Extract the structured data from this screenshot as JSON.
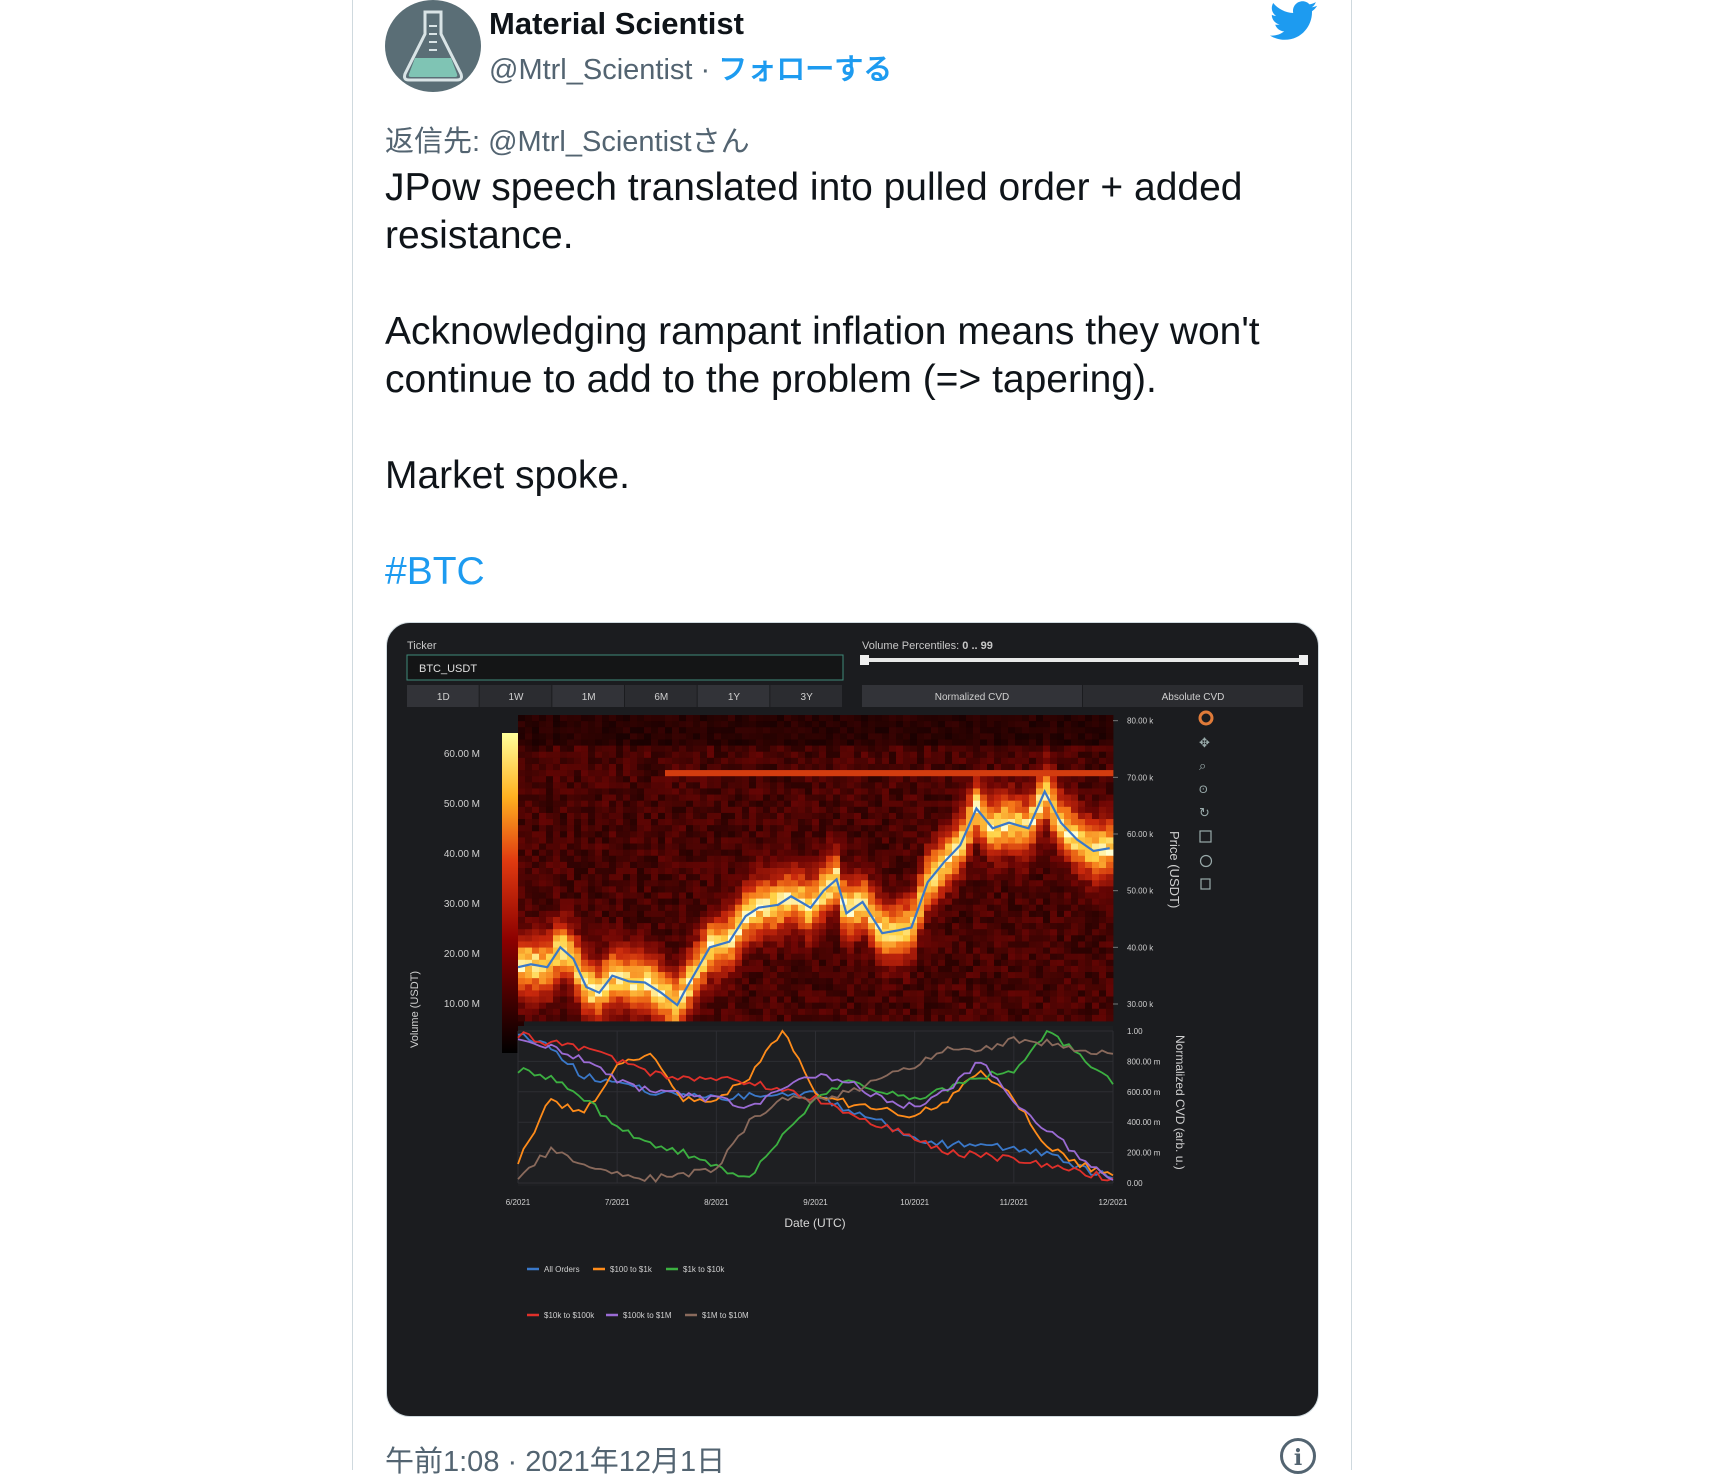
{
  "tweet": {
    "author_name": "Material Scientist",
    "author_handle": "@Mtrl_Scientist",
    "separator": " · ",
    "follow_label": "フォローする",
    "reply_to": "返信先: @Mtrl_Scientistさん",
    "paragraphs": [
      "JPow speech translated into pulled order + added resistance.",
      "Acknowledging rampant inflation means they won't continue to add to the problem (=> tapering).",
      "Market spoke."
    ],
    "hashtag": "#BTC",
    "timestamp": "午前1:08 · 2021年12月1日"
  },
  "dashboard": {
    "ticker_label": "Ticker",
    "ticker_value": "BTC_USDT",
    "percentile_label": "Volume Percentiles:",
    "percentile_value": "0 .. 99",
    "timeframes": [
      "1D",
      "1W",
      "1M",
      "6M",
      "1Y",
      "3Y"
    ],
    "cvd_modes": [
      "Normalized CVD",
      "Absolute CVD"
    ]
  },
  "chart_data": [
    {
      "type": "heatmap",
      "colorbar_title": "Volume (USDT)",
      "colorbar_ticks": [
        "60.00 M",
        "50.00 M",
        "40.00 M",
        "30.00 M",
        "20.00 M",
        "10.00 M"
      ],
      "colorbar_range": [
        0,
        64
      ],
      "ylabel": "Price (USDT)",
      "y_ticks": [
        "80.00 k",
        "70.00 k",
        "60.00 k",
        "50.00 k",
        "40.00 k",
        "30.00 k"
      ],
      "ylim": [
        27000,
        81000
      ],
      "price_series": {
        "dates": [
          "2021-06-01",
          "2021-06-05",
          "2021-06-10",
          "2021-06-14",
          "2021-06-18",
          "2021-06-22",
          "2021-06-26",
          "2021-06-30",
          "2021-07-05",
          "2021-07-10",
          "2021-07-15",
          "2021-07-20",
          "2021-07-22",
          "2021-07-26",
          "2021-07-30",
          "2021-08-05",
          "2021-08-10",
          "2021-08-14",
          "2021-08-20",
          "2021-08-24",
          "2021-08-30",
          "2021-09-03",
          "2021-09-07",
          "2021-09-10",
          "2021-09-15",
          "2021-09-21",
          "2021-09-26",
          "2021-09-30",
          "2021-10-05",
          "2021-10-10",
          "2021-10-15",
          "2021-10-20",
          "2021-10-25",
          "2021-10-30",
          "2021-11-05",
          "2021-11-10",
          "2021-11-15",
          "2021-11-20",
          "2021-11-25",
          "2021-11-30"
        ],
        "prices": [
          36500,
          37000,
          36500,
          40000,
          38000,
          33000,
          32000,
          35000,
          34000,
          33800,
          32000,
          29800,
          32000,
          36000,
          40000,
          41000,
          45500,
          47000,
          47500,
          49000,
          47000,
          50000,
          52000,
          46000,
          48000,
          42500,
          43000,
          43500,
          51500,
          55000,
          58000,
          64500,
          61000,
          62000,
          61000,
          67500,
          62000,
          59000,
          57000,
          57500
        ]
      },
      "x_ticks": [
        "6/2021",
        "7/2021",
        "8/2021",
        "9/2021",
        "10/2021",
        "11/2021",
        "12/2021"
      ]
    },
    {
      "type": "line",
      "xlabel": "Date (UTC)",
      "ylabel": "Normalized CVD (arb. u.)",
      "y_ticks": [
        "1.00",
        "800.00 m",
        "600.00 m",
        "400.00 m",
        "200.00 m",
        "0.00"
      ],
      "ylim": [
        0,
        1
      ],
      "x_ticks": [
        "6/2021",
        "7/2021",
        "8/2021",
        "9/2021",
        "10/2021",
        "11/2021",
        "12/2021"
      ],
      "x": [
        "6/1",
        "6/10",
        "6/20",
        "7/1",
        "7/10",
        "7/20",
        "8/1",
        "8/10",
        "8/20",
        "9/1",
        "9/10",
        "9/20",
        "10/1",
        "10/10",
        "10/20",
        "11/1",
        "11/10",
        "11/20",
        "12/1"
      ],
      "series": [
        {
          "name": "All Orders",
          "color": "#3a78c9",
          "values": [
            1.0,
            0.88,
            0.7,
            0.66,
            0.6,
            0.58,
            0.55,
            0.57,
            0.6,
            0.58,
            0.47,
            0.4,
            0.28,
            0.25,
            0.27,
            0.22,
            0.2,
            0.1,
            0.03
          ]
        },
        {
          "name": "$100 to $1k",
          "color": "#ff8c1a",
          "values": [
            0.15,
            0.55,
            0.45,
            0.78,
            0.85,
            0.55,
            0.55,
            0.7,
            1.0,
            0.6,
            0.52,
            0.48,
            0.45,
            0.55,
            0.75,
            0.55,
            0.25,
            0.12,
            0.05
          ]
        },
        {
          "name": "$1k to $10k",
          "color": "#3cb041",
          "values": [
            0.75,
            0.7,
            0.55,
            0.38,
            0.25,
            0.2,
            0.1,
            0.05,
            0.3,
            0.55,
            0.68,
            0.6,
            0.55,
            0.62,
            0.7,
            0.75,
            1.0,
            0.85,
            0.65
          ]
        },
        {
          "name": "$10k to $100k",
          "color": "#e0302a",
          "values": [
            0.98,
            0.92,
            0.88,
            0.8,
            0.72,
            0.7,
            0.68,
            0.66,
            0.62,
            0.55,
            0.45,
            0.38,
            0.3,
            0.2,
            0.18,
            0.16,
            0.12,
            0.07,
            0.03
          ]
        },
        {
          "name": "$100k to $1M",
          "color": "#9b6bd4",
          "values": [
            0.97,
            0.9,
            0.8,
            0.68,
            0.6,
            0.58,
            0.55,
            0.5,
            0.62,
            0.7,
            0.68,
            0.55,
            0.5,
            0.62,
            0.8,
            0.55,
            0.35,
            0.18,
            0.02
          ]
        },
        {
          "name": "$1M to $10M",
          "color": "#8a6a5c",
          "values": [
            0.05,
            0.22,
            0.1,
            0.05,
            0.03,
            0.05,
            0.1,
            0.4,
            0.55,
            0.55,
            0.6,
            0.68,
            0.78,
            0.9,
            0.88,
            0.95,
            0.92,
            0.88,
            0.85
          ]
        }
      ]
    }
  ]
}
